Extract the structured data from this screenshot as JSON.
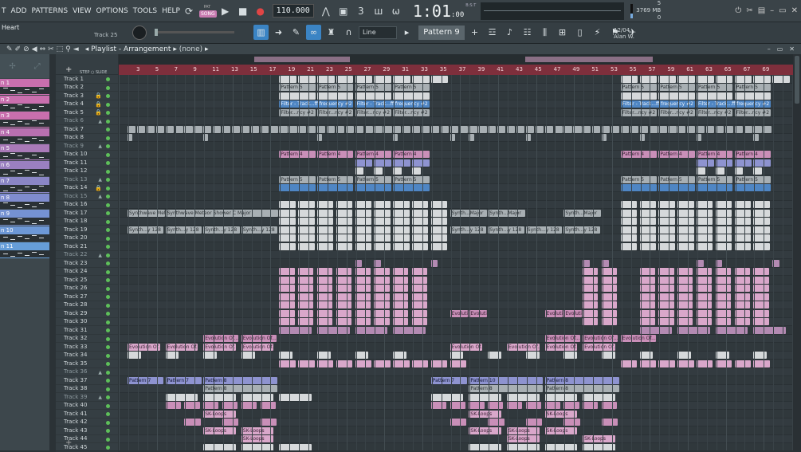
{
  "menu": [
    "T",
    "ADD",
    "PATTERNS",
    "VIEW",
    "OPTIONS",
    "TOOLS",
    "HELP"
  ],
  "transport": {
    "song_label": "SONG",
    "pat_label": "PAT",
    "tempo": "110.000"
  },
  "time": {
    "main": "1:01",
    "sub": ":00",
    "bst": "B:S:T"
  },
  "cpu": {
    "voices": "5",
    "memory": "3769 MB",
    "zero": "0"
  },
  "hint": {
    "project": "Heart",
    "track": "Track 25"
  },
  "toolbar2": {
    "snap": "Line",
    "pattern": "Pattern 9"
  },
  "user": {
    "date": "12/04",
    "name": "Alan W."
  },
  "playlist": {
    "title": "Playlist - Arrangement",
    "sub": "(none)"
  },
  "picker_header": {
    "step": "STEP",
    "slide": "SLIDE"
  },
  "picker": [
    {
      "label": "n 1",
      "color": "#c96fae"
    },
    {
      "label": "n 2",
      "color": "#c96fae"
    },
    {
      "label": "n 3",
      "color": "#c96fae"
    },
    {
      "label": "n 4",
      "color": "#b870b0"
    },
    {
      "label": "n 5",
      "color": "#a97ab8"
    },
    {
      "label": "n 6",
      "color": "#9a80c0"
    },
    {
      "label": "n 7",
      "color": "#8a86c6"
    },
    {
      "label": "n 8",
      "color": "#7f8cce"
    },
    {
      "label": "n 9",
      "color": "#7592d2"
    },
    {
      "label": "n 10",
      "color": "#6d98d6"
    },
    {
      "label": "n 11",
      "color": "#669ed8"
    }
  ],
  "tracks": [
    "Track 1",
    "Track 2",
    "Track 3",
    "Track 4",
    "Track 5",
    "Track 6",
    "Track 7",
    "Track 8",
    "Track 9",
    "Track 10",
    "Track 11",
    "Track 12",
    "Track 13",
    "Track 14",
    "Track 15",
    "Track 16",
    "Track 17",
    "Track 18",
    "Track 19",
    "Track 20",
    "Track 21",
    "Track 22",
    "Track 23",
    "Track 24",
    "Track 25",
    "Track 26",
    "Track 27",
    "Track 28",
    "Track 29",
    "Track 30",
    "Track 31",
    "Track 32",
    "Track 33",
    "Track 34",
    "Track 35",
    "Track 36",
    "Track 37",
    "Track 38",
    "Track 39",
    "Track 40",
    "Track 41",
    "Track 42",
    "Track 43",
    "Track 44",
    "Track 45"
  ],
  "ruler": [
    "3",
    "5",
    "7",
    "9",
    "11",
    "13",
    "15",
    "17",
    "19",
    "21",
    "23",
    "25",
    "27",
    "29",
    "31",
    "33",
    "35",
    "37",
    "39",
    "41",
    "43",
    "45",
    "47",
    "49",
    "51",
    "53",
    "55",
    "57",
    "59",
    "61",
    "63",
    "65",
    "67",
    "69"
  ],
  "clips": {
    "pattern4": "Pattern 4",
    "pattern5": "Pattern 5",
    "pattern7": "Pattern 7",
    "pattern8": "Pattern 8",
    "pattern10": "Pattern 10",
    "filter": "Filter - Track...ff frequency #2",
    "filter_short": "Filter...ncy #2",
    "synth_major": "Synthwave Meteor Shower C Major",
    "synth_short": "Synth...y 128",
    "synth_major_short": "Synth...Major",
    "evolution": "Evolution Of...#2",
    "evolution_short": "Evolution Of...",
    "sk_loop": "SK-Loops"
  },
  "colors": {
    "pink": "#c98fb8",
    "blue": "#4f86c4",
    "gray": "#a8afb3",
    "ruler": "#7e2f3c"
  }
}
